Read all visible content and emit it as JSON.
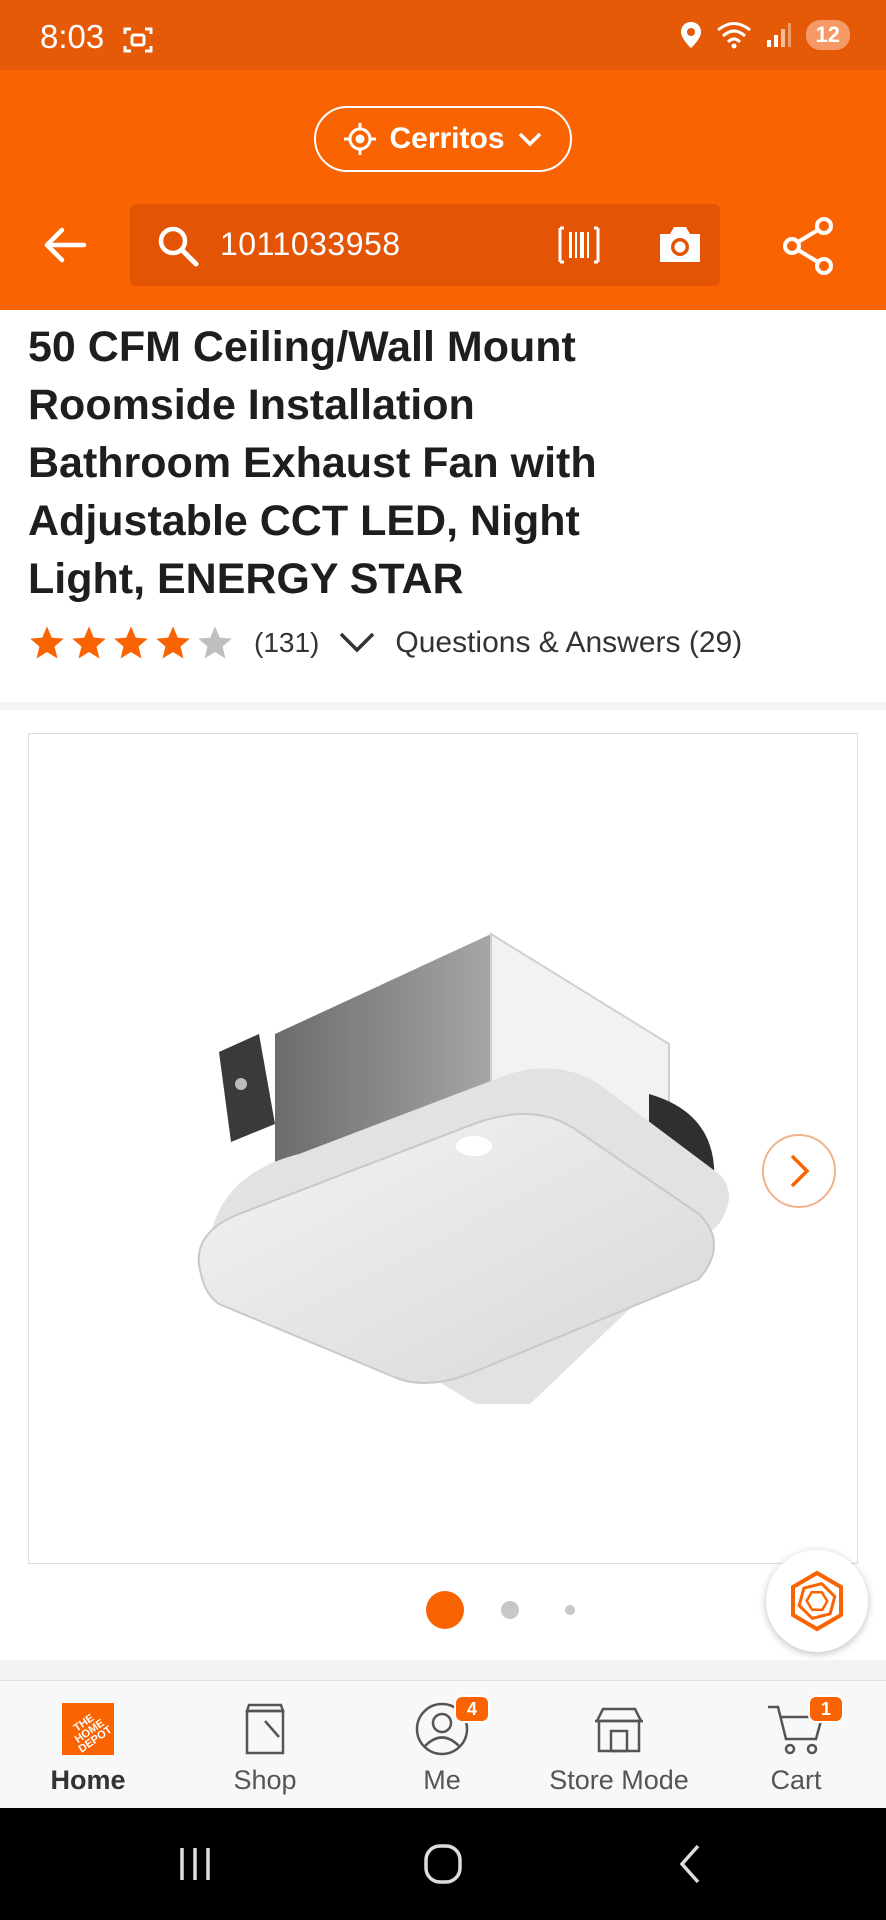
{
  "status_bar": {
    "time": "8:03",
    "battery": "12",
    "colors": {
      "bg": "#e45a06"
    }
  },
  "header": {
    "store_name": "Cerritos",
    "search_value": "1011033958",
    "colors": {
      "bg": "#f96302"
    }
  },
  "product": {
    "title": "50 CFM Ceiling/Wall Mount Roomside Installation Bathroom Exhaust Fan with Adjustable CCT LED, Night Light, ENERGY STAR",
    "rating": 4,
    "rating_max": 5,
    "review_count": "(131)",
    "qa_label": "Questions & Answers (29)",
    "image_count": 3,
    "current_image": 1
  },
  "bottom_nav": {
    "items": [
      {
        "label": "Home",
        "icon": "home-depot-logo-icon",
        "active": true
      },
      {
        "label": "Shop",
        "icon": "shop-bag-icon"
      },
      {
        "label": "Me",
        "icon": "user-icon",
        "badge": "4"
      },
      {
        "label": "Store Mode",
        "icon": "store-icon"
      },
      {
        "label": "Cart",
        "icon": "cart-icon",
        "badge": "1"
      }
    ]
  },
  "brand": {
    "accent": "#f96302"
  }
}
